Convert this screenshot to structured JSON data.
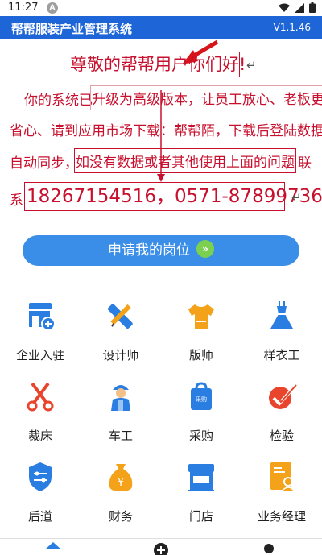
{
  "status": {
    "time": "11:27",
    "notif": "A"
  },
  "app": {
    "title": "帮帮服装产业管理系统",
    "version": "V1.1.46"
  },
  "notice": {
    "greeting": "尊敬的帮帮用户你们好!",
    "line1_a": "你的系统已",
    "line1_b": "升级为高级版本，让员工放心、老板更",
    "line2": "省心、请到应用市场下载：帮帮陌，下载后登陆数据",
    "line3_a": "自动同步，",
    "line3_b": "如没有数据或者其他使用上面的问题",
    "line3_c": "，联",
    "line4_a": "系",
    "phone": "18267154516，0571-87899736",
    "return_mark": "↵",
    "accent": "#c8102e"
  },
  "apply_button": {
    "label": "申请我的岗位",
    "icon": "double-chevron-right-icon"
  },
  "grid": [
    {
      "label": "企业入驻",
      "icon": "shop-add-icon",
      "color": "#2a7de1"
    },
    {
      "label": "设计师",
      "icon": "ruler-pencil-icon",
      "color": "#2a7de1"
    },
    {
      "label": "版师",
      "icon": "shirt-icon",
      "color": "#f3a21a"
    },
    {
      "label": "样衣工",
      "icon": "dress-icon",
      "color": "#2a7de1"
    },
    {
      "label": "裁床",
      "icon": "scissors-icon",
      "color": "#e8452c"
    },
    {
      "label": "车工",
      "icon": "worker-icon",
      "color": "#2a7de1"
    },
    {
      "label": "采购",
      "icon": "shopping-bag-icon",
      "color": "#2a7de1"
    },
    {
      "label": "检验",
      "icon": "check-badge-icon",
      "color": "#e8452c"
    },
    {
      "label": "后道",
      "icon": "shield-sliders-icon",
      "color": "#2a7de1"
    },
    {
      "label": "财务",
      "icon": "money-bag-icon",
      "color": "#f3a21a"
    },
    {
      "label": "门店",
      "icon": "store-icon",
      "color": "#2a7de1"
    },
    {
      "label": "业务经理",
      "icon": "id-card-icon",
      "color": "#f3a21a"
    }
  ]
}
